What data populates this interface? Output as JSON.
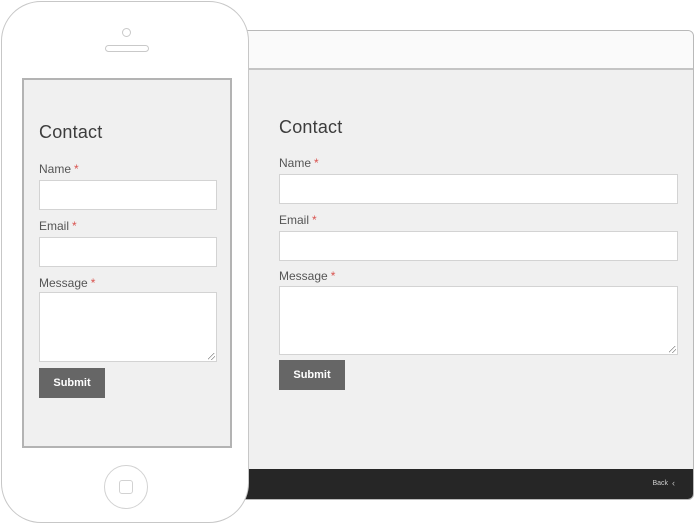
{
  "mobile": {
    "title": "Contact",
    "name_label": "Name",
    "email_label": "Email",
    "message_label": "Message",
    "required_mark": "*",
    "submit_label": "Submit"
  },
  "desktop": {
    "title": "Contact",
    "name_label": "Name",
    "email_label": "Email",
    "message_label": "Message",
    "required_mark": "*",
    "submit_label": "Submit",
    "footer_back_label": "Back",
    "footer_back_icon": "chevron-left-icon"
  },
  "colors": {
    "background": "#f0f0f0",
    "required": "#d9534f",
    "button": "#666666",
    "footer": "#262626"
  }
}
